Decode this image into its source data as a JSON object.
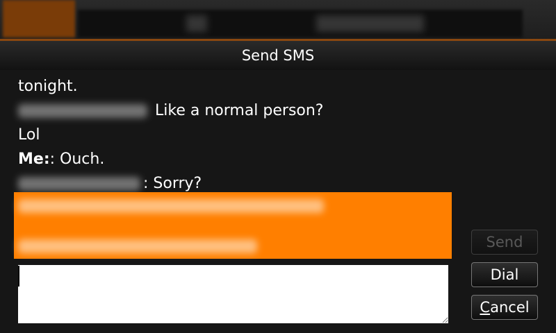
{
  "dialog": {
    "title": "Send SMS"
  },
  "conversation": {
    "lines": [
      {
        "sender_visible": false,
        "sender": "",
        "text": "tonight."
      },
      {
        "sender_visible": true,
        "sender": "",
        "text": " Like a normal person?"
      },
      {
        "sender_visible": false,
        "sender": "",
        "text": "Lol"
      },
      {
        "sender_visible": true,
        "sender": "Me:",
        "text": ": Ouch."
      },
      {
        "sender_visible": true,
        "sender": "",
        "text": ": Sorry?"
      }
    ]
  },
  "highlighted_message": {
    "color": "#ff7f00"
  },
  "compose": {
    "value": "",
    "placeholder": ""
  },
  "buttons": {
    "send_label": "Send",
    "dial_label": "Dial",
    "cancel_accel": "C",
    "cancel_rest": "ancel"
  },
  "colors": {
    "accent": "#ff7f00",
    "background": "#161616",
    "text": "#ffffff"
  }
}
